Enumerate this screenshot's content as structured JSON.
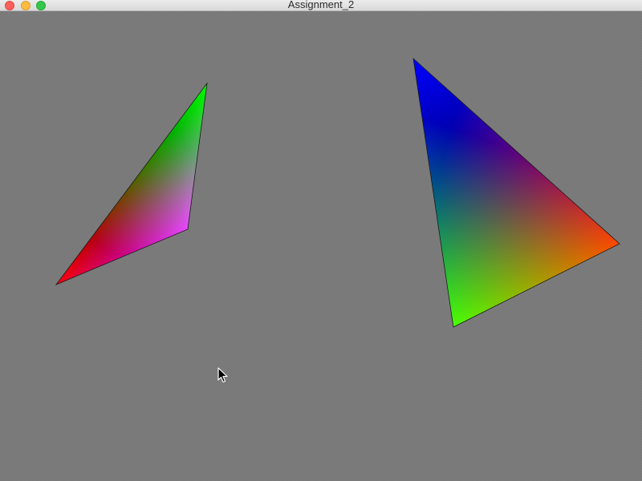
{
  "window": {
    "title": "Assignment_2"
  },
  "icons": {
    "close": "close-window-icon",
    "minimize": "minimize-window-icon",
    "zoom": "zoom-window-icon",
    "cursor": "mouse-pointer-icon"
  },
  "colors": {
    "background": "#7d7d7d",
    "vertex_red": "#ff0000",
    "vertex_green": "#00ff00",
    "vertex_blue": "#0000ff",
    "vertex_magenta": "#e000ff"
  }
}
